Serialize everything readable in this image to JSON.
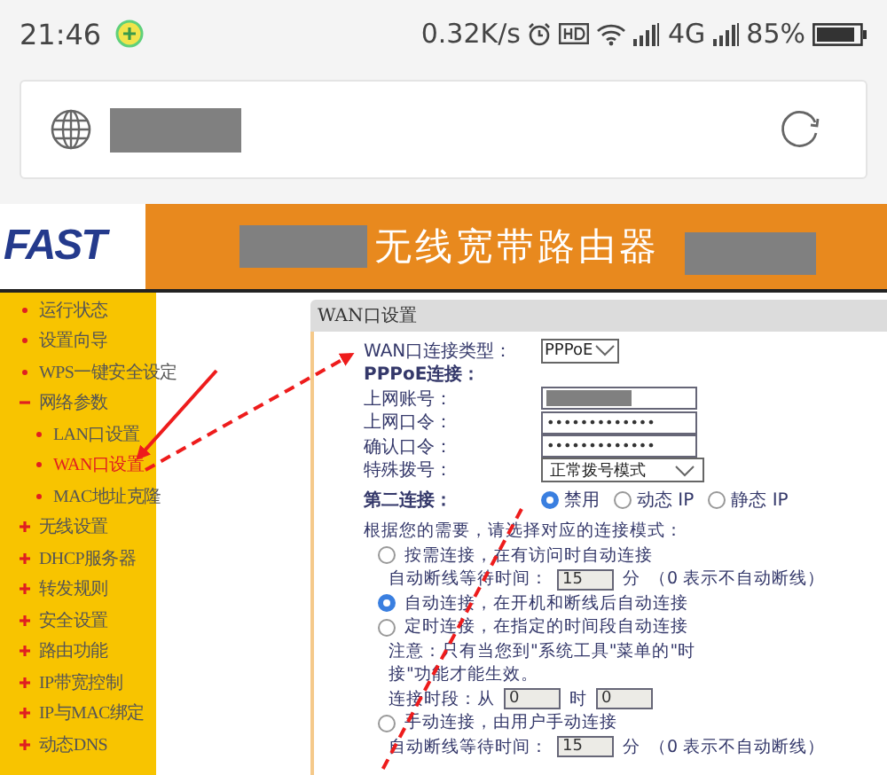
{
  "status_bar": {
    "time": "21:46",
    "speed": "0.32K/s",
    "network": "4G",
    "battery": "85%"
  },
  "header": {
    "logo": "FAST",
    "title": "无线宽带路由器"
  },
  "sidebar": {
    "items": [
      {
        "label": "运行状态",
        "selected": false
      },
      {
        "label": "设置向导",
        "selected": false
      },
      {
        "label": "WPS一键安全设定",
        "selected": false
      },
      {
        "label": "网络参数",
        "selected": false,
        "expanded": true,
        "children": [
          {
            "label": "LAN口设置",
            "selected": false
          },
          {
            "label": "WAN口设置",
            "selected": true
          },
          {
            "label": "MAC地址克隆",
            "selected": false
          }
        ]
      },
      {
        "label": "无线设置",
        "selected": false,
        "expanded": false
      },
      {
        "label": "DHCP服务器",
        "selected": false,
        "expanded": false
      },
      {
        "label": "转发规则",
        "selected": false,
        "expanded": false
      },
      {
        "label": "安全设置",
        "selected": false,
        "expanded": false
      },
      {
        "label": "路由功能",
        "selected": false,
        "expanded": false
      },
      {
        "label": "IP带宽控制",
        "selected": false,
        "expanded": false
      },
      {
        "label": "IP与MAC绑定",
        "selected": false,
        "expanded": false
      },
      {
        "label": "动态DNS",
        "selected": false,
        "expanded": false
      }
    ]
  },
  "panel": {
    "title": "WAN口设置",
    "fields": [
      {
        "kind": "select",
        "label": "WAN口连接类型：",
        "value": "PPPoE"
      },
      {
        "kind": "heading",
        "label": "PPPoE连接："
      },
      {
        "kind": "redacted",
        "label": "上网账号："
      },
      {
        "kind": "input",
        "label": "上网口令：",
        "value": "•••••••••••••"
      },
      {
        "kind": "input",
        "label": "确认口令：",
        "value": "•••••••••••••"
      },
      {
        "kind": "select",
        "label": "特殊拨号：",
        "value": "正常拨号模式"
      }
    ],
    "second_connection": {
      "label": "第二连接：",
      "options": [
        {
          "label": "禁用",
          "selected": true
        },
        {
          "label": "动态 IP",
          "selected": false
        },
        {
          "label": "静态 IP",
          "selected": false
        }
      ]
    },
    "modes_intro": "根据您的需要，请选择对应的连接模式：",
    "modes": [
      {
        "label": "按需连接，在有访问时自动连接",
        "selected": false,
        "wait": {
          "label": "自动断线等待时间：",
          "value": "15",
          "unit": "分",
          "note": "（0 表示不自动断线）"
        }
      },
      {
        "label": "自动连接，在开机和断线后自动连接",
        "selected": true
      },
      {
        "label": "定时连接，在指定的时间段自动连接",
        "selected": false,
        "notes": [
          "注意：只有当您到\"系统工具\"菜单的\"时",
          "接\"功能才能生效。"
        ],
        "period": {
          "label": "连接时段：从",
          "from": "0",
          "hour": "时",
          "to": "0"
        }
      },
      {
        "label": "手动连接，由用户手动连接",
        "selected": false,
        "wait": {
          "label": "自动断线等待时间：",
          "value": "15",
          "unit": "分",
          "note": "（0 表示不自动断线）"
        }
      }
    ]
  }
}
